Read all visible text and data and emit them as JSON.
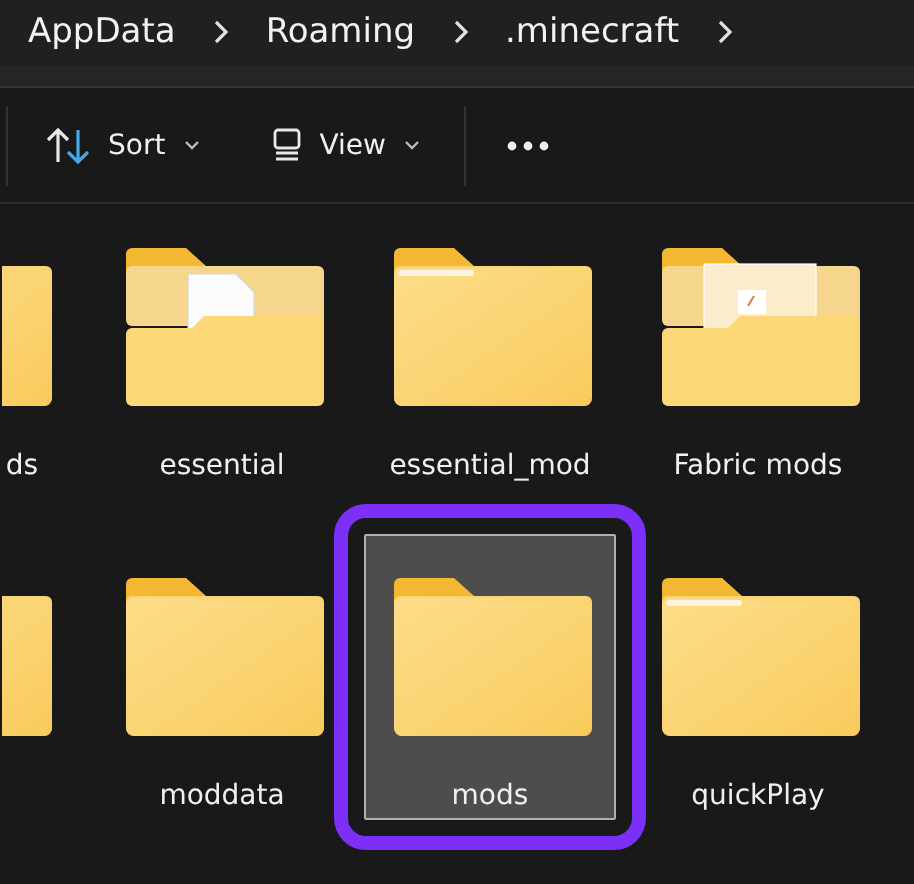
{
  "breadcrumb": [
    "AppData",
    "Roaming",
    ".minecraft"
  ],
  "toolbar": {
    "sort": "Sort",
    "view": "View"
  },
  "folders": [
    {
      "name": "ds",
      "kind": "paper",
      "selected": false,
      "highlighted": false
    },
    {
      "name": "essential",
      "kind": "document",
      "selected": false,
      "highlighted": false
    },
    {
      "name": "essential_mod",
      "kind": "paper",
      "selected": false,
      "highlighted": false
    },
    {
      "name": "Fabric mods",
      "kind": "image",
      "selected": false,
      "highlighted": false
    },
    {
      "kind": "paper",
      "selected": false,
      "highlighted": false
    },
    {
      "name": "moddata",
      "kind": "plain",
      "selected": false,
      "highlighted": false
    },
    {
      "name": "mods",
      "kind": "plain",
      "selected": true,
      "highlighted": true
    },
    {
      "name": "quickPlay",
      "kind": "paper",
      "selected": false,
      "highlighted": false
    }
  ]
}
